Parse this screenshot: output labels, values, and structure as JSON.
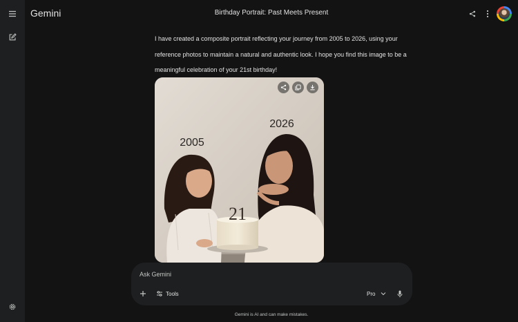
{
  "app": {
    "name": "Gemini"
  },
  "header": {
    "title": "Birthday Portrait: Past Meets Present"
  },
  "message": {
    "text": "I have created a composite portrait reflecting your journey from 2005 to 2026, using your reference photos to maintain a natural and authentic look. I hope you find this image to be a meaningful celebration of your 21st birthday!"
  },
  "image": {
    "year_left": "2005",
    "year_right": "2026",
    "cake_number": "21"
  },
  "composer": {
    "placeholder": "Ask Gemini",
    "tools_label": "Tools",
    "model_label": "Pro"
  },
  "footer": {
    "disclaimer": "Gemini is AI and can make mistakes."
  },
  "icons": {
    "menu": "menu-icon",
    "new_chat": "edit-icon",
    "settings": "gear-icon",
    "share": "share-icon",
    "more": "more-vert-icon",
    "copy": "copy-icon",
    "download": "download-icon",
    "plus": "plus-icon",
    "tools": "tune-icon",
    "chevron": "chevron-down-icon",
    "mic": "mic-icon"
  },
  "colors": {
    "background": "#131314",
    "surface": "#1e1f20",
    "text": "#e3e3e3",
    "muted_text": "#c4c7c5"
  }
}
